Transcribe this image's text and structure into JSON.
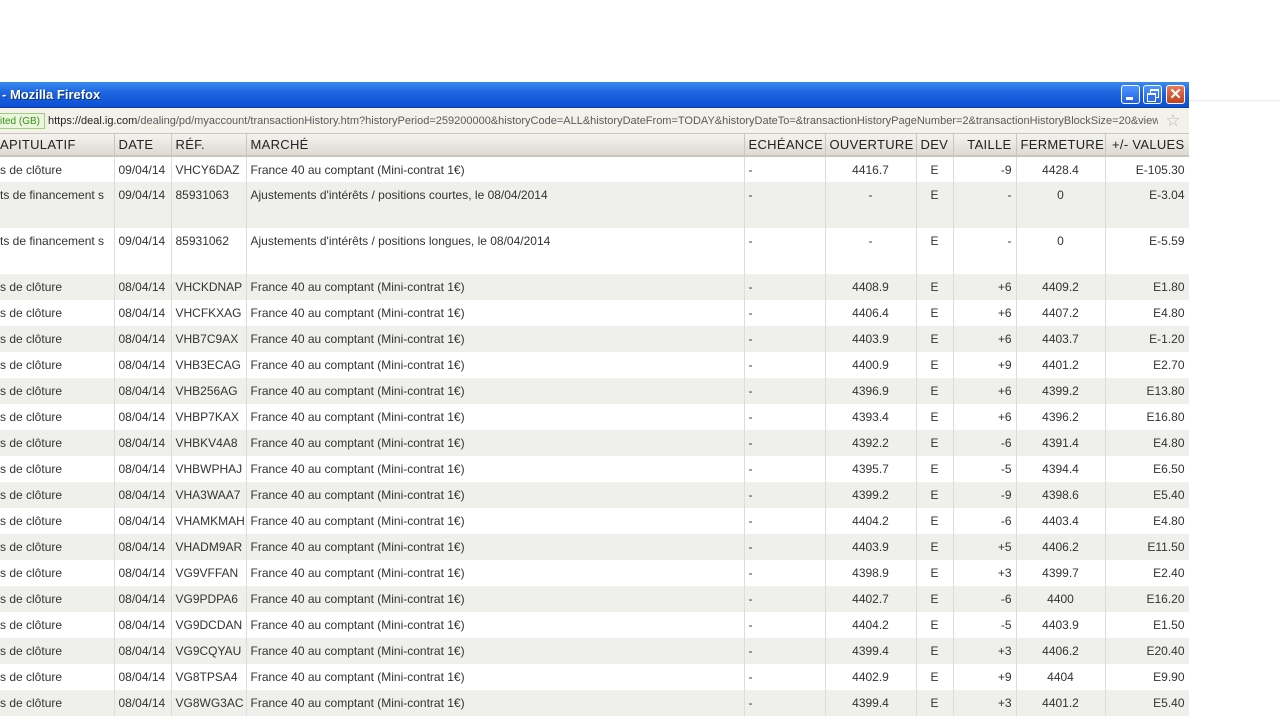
{
  "window": {
    "title": "- Mozilla Firefox",
    "buttons": [
      "minimize",
      "restore",
      "close"
    ]
  },
  "urlbar": {
    "site_badge": "ited (GB)",
    "url_host": "https://deal.ig.com",
    "url_path": "/dealing/pd/myaccount/transactionHistory.htm?historyPeriod=259200000&historyCode=ALL&historyDateFrom=TODAY&historyDateTo=&transactionHistoryPageNumber=2&transactionHistoryBlockSize=20&view=",
    "bookmark_icon": "star-icon"
  },
  "table": {
    "headers": [
      "APITULATIF",
      "DATE",
      "RÉF.",
      "MARCHÉ",
      "ECHÉANCE",
      "OUVERTURE",
      "DEV",
      "TAILLE",
      "FERMETURE",
      "+/- VALUES"
    ],
    "rows": [
      {
        "type": "s de clôture",
        "date": "09/04/14",
        "ref": "VHCY6DAZ",
        "market": "France 40 au comptant (Mini-contrat 1€)",
        "expiry": "-",
        "open": "4416.7",
        "cur": "E",
        "size": "-9",
        "close": "4428.4",
        "pnl": "E-105.30"
      },
      {
        "type": "ts de financement s",
        "date": "09/04/14",
        "ref": "85931063",
        "market": "Ajustements d'intérêts / positions courtes, le 08/04/2014",
        "expiry": "-",
        "open": "-",
        "cur": "E",
        "size": "-",
        "close": "0",
        "pnl": "E-3.04"
      },
      {
        "type": "ts de financement s",
        "date": "09/04/14",
        "ref": "85931062",
        "market": "Ajustements d'intérêts / positions longues, le 08/04/2014",
        "expiry": "-",
        "open": "-",
        "cur": "E",
        "size": "-",
        "close": "0",
        "pnl": "E-5.59"
      },
      {
        "type": "s de clôture",
        "date": "08/04/14",
        "ref": "VHCKDNAP",
        "market": "France 40 au comptant (Mini-contrat 1€)",
        "expiry": "-",
        "open": "4408.9",
        "cur": "E",
        "size": "+6",
        "close": "4409.2",
        "pnl": "E1.80"
      },
      {
        "type": "s de clôture",
        "date": "08/04/14",
        "ref": "VHCFKXAG",
        "market": "France 40 au comptant (Mini-contrat 1€)",
        "expiry": "-",
        "open": "4406.4",
        "cur": "E",
        "size": "+6",
        "close": "4407.2",
        "pnl": "E4.80"
      },
      {
        "type": "s de clôture",
        "date": "08/04/14",
        "ref": "VHB7C9AX",
        "market": "France 40 au comptant (Mini-contrat 1€)",
        "expiry": "-",
        "open": "4403.9",
        "cur": "E",
        "size": "+6",
        "close": "4403.7",
        "pnl": "E-1.20"
      },
      {
        "type": "s de clôture",
        "date": "08/04/14",
        "ref": "VHB3ECAG",
        "market": "France 40 au comptant (Mini-contrat 1€)",
        "expiry": "-",
        "open": "4400.9",
        "cur": "E",
        "size": "+9",
        "close": "4401.2",
        "pnl": "E2.70"
      },
      {
        "type": "s de clôture",
        "date": "08/04/14",
        "ref": "VHB256AG",
        "market": "France 40 au comptant (Mini-contrat 1€)",
        "expiry": "-",
        "open": "4396.9",
        "cur": "E",
        "size": "+6",
        "close": "4399.2",
        "pnl": "E13.80"
      },
      {
        "type": "s de clôture",
        "date": "08/04/14",
        "ref": "VHBP7KAX",
        "market": "France 40 au comptant (Mini-contrat 1€)",
        "expiry": "-",
        "open": "4393.4",
        "cur": "E",
        "size": "+6",
        "close": "4396.2",
        "pnl": "E16.80"
      },
      {
        "type": "s de clôture",
        "date": "08/04/14",
        "ref": "VHBKV4A8",
        "market": "France 40 au comptant (Mini-contrat 1€)",
        "expiry": "-",
        "open": "4392.2",
        "cur": "E",
        "size": "-6",
        "close": "4391.4",
        "pnl": "E4.80"
      },
      {
        "type": "s de clôture",
        "date": "08/04/14",
        "ref": "VHBWPHAJ",
        "market": "France 40 au comptant (Mini-contrat 1€)",
        "expiry": "-",
        "open": "4395.7",
        "cur": "E",
        "size": "-5",
        "close": "4394.4",
        "pnl": "E6.50"
      },
      {
        "type": "s de clôture",
        "date": "08/04/14",
        "ref": "VHA3WAA7",
        "market": "France 40 au comptant (Mini-contrat 1€)",
        "expiry": "-",
        "open": "4399.2",
        "cur": "E",
        "size": "-9",
        "close": "4398.6",
        "pnl": "E5.40"
      },
      {
        "type": "s de clôture",
        "date": "08/04/14",
        "ref": "VHAMKMAH",
        "market": "France 40 au comptant (Mini-contrat 1€)",
        "expiry": "-",
        "open": "4404.2",
        "cur": "E",
        "size": "-6",
        "close": "4403.4",
        "pnl": "E4.80"
      },
      {
        "type": "s de clôture",
        "date": "08/04/14",
        "ref": "VHADM9AR",
        "market": "France 40 au comptant (Mini-contrat 1€)",
        "expiry": "-",
        "open": "4403.9",
        "cur": "E",
        "size": "+5",
        "close": "4406.2",
        "pnl": "E11.50"
      },
      {
        "type": "s de clôture",
        "date": "08/04/14",
        "ref": "VG9VFFAN",
        "market": "France 40 au comptant (Mini-contrat 1€)",
        "expiry": "-",
        "open": "4398.9",
        "cur": "E",
        "size": "+3",
        "close": "4399.7",
        "pnl": "E2.40"
      },
      {
        "type": "s de clôture",
        "date": "08/04/14",
        "ref": "VG9PDPA6",
        "market": "France 40 au comptant (Mini-contrat 1€)",
        "expiry": "-",
        "open": "4402.7",
        "cur": "E",
        "size": "-6",
        "close": "4400",
        "pnl": "E16.20"
      },
      {
        "type": "s de clôture",
        "date": "08/04/14",
        "ref": "VG9DCDAN",
        "market": "France 40 au comptant (Mini-contrat 1€)",
        "expiry": "-",
        "open": "4404.2",
        "cur": "E",
        "size": "-5",
        "close": "4403.9",
        "pnl": "E1.50"
      },
      {
        "type": "s de clôture",
        "date": "08/04/14",
        "ref": "VG9CQYAU",
        "market": "France 40 au comptant (Mini-contrat 1€)",
        "expiry": "-",
        "open": "4399.4",
        "cur": "E",
        "size": "+3",
        "close": "4406.2",
        "pnl": "E20.40"
      },
      {
        "type": "s de clôture",
        "date": "08/04/14",
        "ref": "VG8TPSA4",
        "market": "France 40 au comptant (Mini-contrat 1€)",
        "expiry": "-",
        "open": "4402.9",
        "cur": "E",
        "size": "+9",
        "close": "4404",
        "pnl": "E9.90"
      },
      {
        "type": "s de clôture",
        "date": "08/04/14",
        "ref": "VG8WG3AC",
        "market": "France 40 au comptant (Mini-contrat 1€)",
        "expiry": "-",
        "open": "4399.4",
        "cur": "E",
        "size": "+3",
        "close": "4401.2",
        "pnl": "E5.40"
      }
    ]
  }
}
